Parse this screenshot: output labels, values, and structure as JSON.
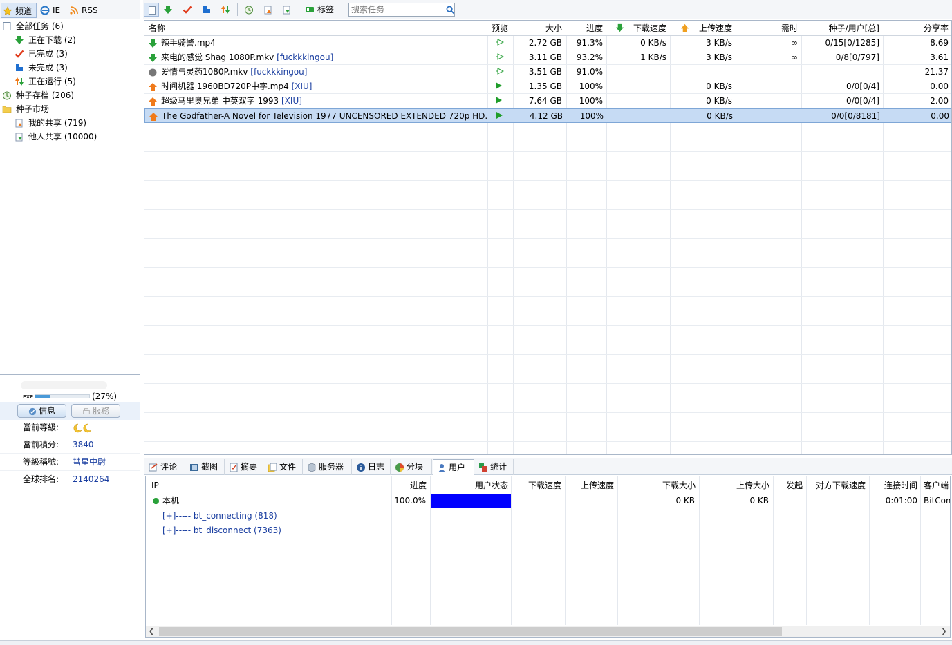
{
  "left_tabs": {
    "channel": "频道",
    "ie": "IE",
    "rss": "RSS"
  },
  "tree": [
    {
      "label": "全部任务 (6)",
      "icon": "all-tasks-icon"
    },
    {
      "label": "正在下载 (2)",
      "icon": "download-arrow-icon"
    },
    {
      "label": "已完成 (3)",
      "icon": "check-icon"
    },
    {
      "label": "未完成 (3)",
      "icon": "incomplete-icon"
    },
    {
      "label": "正在运行 (5)",
      "icon": "running-icon"
    },
    {
      "label": "种子存档 (206)",
      "icon": "archive-icon"
    },
    {
      "label": "种子市场",
      "icon": "folder-icon"
    },
    {
      "label": "我的共享 (719)",
      "icon": "my-share-icon"
    },
    {
      "label": "他人共享 (10000)",
      "icon": "others-share-icon"
    }
  ],
  "profile": {
    "exp_label": "EXP",
    "exp_percent": "(27%)",
    "exp_fraction": 0.27,
    "btn_info": "信息",
    "btn_service": "服務",
    "rows": [
      {
        "key": "當前等級:",
        "value": ""
      },
      {
        "key": "當前積分:",
        "value": "3840"
      },
      {
        "key": "等級稱號:",
        "value": "彗星中尉"
      },
      {
        "key": "全球排名:",
        "value": "2140264"
      }
    ]
  },
  "toolbar": {
    "tags_label": "标签",
    "search_placeholder": "搜索任务"
  },
  "grid": {
    "headers": [
      "名称",
      "预览",
      "大小",
      "进度",
      "下载速度",
      "上传速度",
      "需时",
      "种子/用户[总]",
      "分享率"
    ],
    "rows": [
      {
        "name": "辣手骑警.mp4",
        "tag": "",
        "status": "down",
        "preview": "outline",
        "size": "2.72 GB",
        "progress": "91.3%",
        "down": "0 KB/s",
        "up": "3 KB/s",
        "eta": "∞",
        "peers": "0/15[0/1285]",
        "ratio": "8.69"
      },
      {
        "name": "来电的感觉 Shag 1080P.mkv",
        "tag": "[fuckkkingou]",
        "status": "down",
        "preview": "outline",
        "size": "3.11 GB",
        "progress": "93.2%",
        "down": "1 KB/s",
        "up": "3 KB/s",
        "eta": "∞",
        "peers": "0/8[0/797]",
        "ratio": "3.61"
      },
      {
        "name": "爱情与灵药1080P.mkv",
        "tag": "[fuckkkingou]",
        "status": "stopped",
        "preview": "outline",
        "size": "3.51 GB",
        "progress": "91.0%",
        "down": "",
        "up": "",
        "eta": "",
        "peers": "",
        "ratio": "21.37"
      },
      {
        "name": "时间机器 1960BD720P中字.mp4",
        "tag": "[XIU]",
        "status": "up",
        "preview": "solid",
        "size": "1.35 GB",
        "progress": "100%",
        "down": "",
        "up": "0 KB/s",
        "eta": "",
        "peers": "0/0[0/4]",
        "ratio": "0.00"
      },
      {
        "name": "超级马里奥兄弟 中英双字 1993",
        "tag": "[XIU]",
        "status": "up",
        "preview": "solid",
        "size": "7.64 GB",
        "progress": "100%",
        "down": "",
        "up": "0 KB/s",
        "eta": "",
        "peers": "0/0[0/4]",
        "ratio": "2.00"
      },
      {
        "name": "The Godfather-A Novel for Television 1977 UNCENSORED EXTENDED 720p HD...",
        "tag": "",
        "status": "up",
        "preview": "solid",
        "size": "4.12 GB",
        "progress": "100%",
        "down": "",
        "up": "0 KB/s",
        "eta": "",
        "peers": "0/0[0/8181]",
        "ratio": "0.00",
        "selected": true
      }
    ]
  },
  "bottom_tabs": [
    "评论",
    "截图",
    "摘要",
    "文件",
    "服务器",
    "日志",
    "分块",
    "用户",
    "统计"
  ],
  "peers": {
    "headers": [
      "IP",
      "进度",
      "用户状态",
      "下载速度",
      "上传速度",
      "下载大小",
      "上传大小",
      "发起",
      "对方下载速度",
      "连接时间",
      "客户端"
    ],
    "local": {
      "ip": "本机",
      "progress": "100.0%",
      "progress_fraction": 1.0,
      "down_size": "0 KB",
      "up_size": "0 KB",
      "time": "0:01:00",
      "client": "BitComet"
    },
    "groups": [
      "[+]----- bt_connecting (818)",
      "[+]----- bt_disconnect (7363)"
    ]
  },
  "colors": {
    "accent": "#1a3ea0",
    "selection": "#c6dbf4",
    "progress_bar": "#0000ff",
    "down_green": "#1f9d2a",
    "up_orange": "#f07a1a"
  }
}
